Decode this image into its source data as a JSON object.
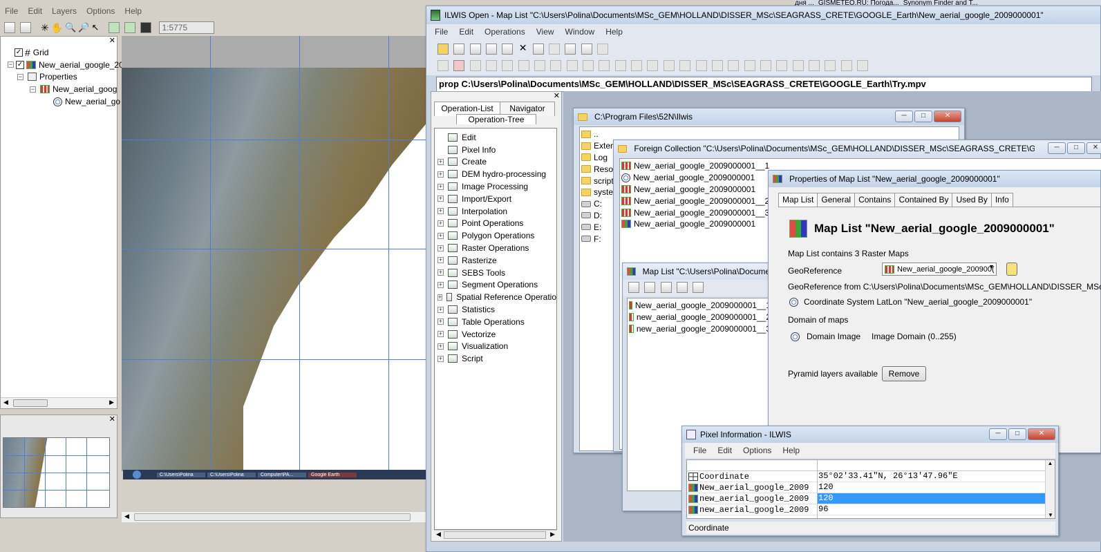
{
  "main_menu": [
    "File",
    "Edit",
    "Layers",
    "Options",
    "Help"
  ],
  "scale_box": "1:5775",
  "layer_tree": {
    "items": [
      {
        "label": "Grid"
      },
      {
        "label": "New_aerial_google_20"
      },
      {
        "label": "Properties"
      },
      {
        "label": "New_aerial_goog"
      },
      {
        "label": "New_aerial_go"
      }
    ]
  },
  "taskbar_items": [
    "C:\\Users\\Polina",
    "C:\\Users\\Polina",
    "Computer\\PA...",
    "Google Earth"
  ],
  "ilwis": {
    "title": "ILWIS Open - Map List \"C:\\Users\\Polina\\Documents\\MSc_GEM\\HOLLAND\\DISSER_MSc\\SEAGRASS_CRETE\\GOOGLE_Earth\\New_aerial_google_2009000001\"",
    "menu": [
      "File",
      "Edit",
      "Operations",
      "View",
      "Window",
      "Help"
    ],
    "command": "prop C:\\Users\\Polina\\Documents\\MSc_GEM\\HOLLAND\\DISSER_MSc\\SEAGRASS_CRETE\\GOOGLE_Earth\\Try.mpv",
    "tabs": [
      "Operation-List",
      "Navigator"
    ],
    "tree_tab": "Operation-Tree",
    "operations": [
      "Edit",
      "Pixel Info",
      "Create",
      "DEM hydro-processing",
      "Image Processing",
      "Import/Export",
      "Interpolation",
      "Point Operations",
      "Polygon Operations",
      "Raster Operations",
      "Rasterize",
      "SEBS Tools",
      "Segment Operations",
      "Spatial Reference Operatio",
      "Statistics",
      "Table Operations",
      "Vectorize",
      "Visualization",
      "Script"
    ]
  },
  "browser_tabs": [
    "дня ...",
    "GISMETEO.RU: Погода...",
    "Synonym Finder and T..."
  ],
  "folder_win": {
    "title": "C:\\Program Files\\52N\\Ilwis",
    "items": [
      "..",
      "Extens",
      "Log",
      "Resou",
      "scripts",
      "system",
      "C:",
      "D:",
      "E:",
      "F:"
    ]
  },
  "foreign_win": {
    "title": "Foreign Collection \"C:\\Users\\Polina\\Documents\\MSc_GEM\\HOLLAND\\DISSER_MSc\\SEAGRASS_CRETE\\GOO...",
    "items": [
      "New_aerial_google_2009000001__1",
      "New_aerial_google_2009000001",
      "New_aerial_google_2009000001",
      "New_aerial_google_2009000001__2",
      "New_aerial_google_2009000001__3",
      "New_aerial_google_2009000001"
    ]
  },
  "maplist_win": {
    "title": "Map List \"C:\\Users\\Polina\\Docume",
    "items": [
      "New_aerial_google_2009000001__1",
      "new_aerial_google_2009000001__2",
      "new_aerial_google_2009000001__3"
    ]
  },
  "props_win": {
    "title": "Properties of Map List \"New_aerial_google_2009000001\"",
    "tabs": [
      "Map List",
      "General",
      "Contains",
      "Contained By",
      "Used By",
      "Info"
    ],
    "heading": "Map List \"New_aerial_google_2009000001\"",
    "contains": "Map List contains 3 Raster Maps",
    "georef_label": "GeoReference",
    "georef_value": "New_aerial_google_200900(",
    "georef_from": "GeoReference from C:\\Users\\Polina\\Documents\\MSc_GEM\\HOLLAND\\DISSER_MSc\\SE",
    "coord_sys": "Coordinate System LatLon \"New_aerial_google_2009000001\"",
    "domain_label": "Domain of maps",
    "domain_name": "Domain Image",
    "domain_desc": "Image Domain (0..255)",
    "pyramid_label": "Pyramid layers available",
    "remove_button": "Remove"
  },
  "pixel_win": {
    "title": "Pixel Information - ILWIS",
    "menu": [
      "File",
      "Edit",
      "Options",
      "Help"
    ],
    "rows": [
      {
        "name": "Coordinate",
        "value": " 35°02'33.41\"N, 26°13'47.96\"E"
      },
      {
        "name": "New_aerial_google_2009",
        "value": "120"
      },
      {
        "name": "new_aerial_google_2009",
        "value": "120"
      },
      {
        "name": "new_aerial_google_2009",
        "value": "96"
      }
    ],
    "status": "Coordinate"
  }
}
